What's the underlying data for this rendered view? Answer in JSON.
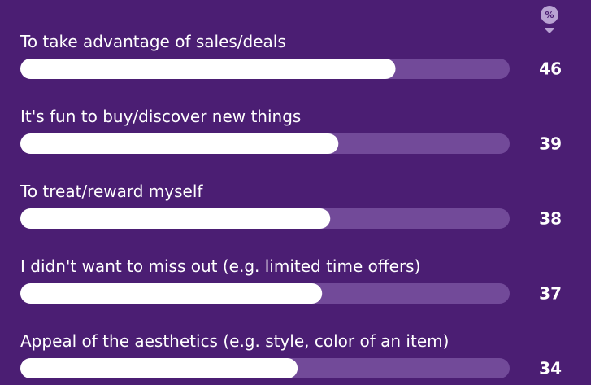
{
  "unit_badge": "%",
  "colors": {
    "background": "#4b1e73",
    "track": "#724a99",
    "fill": "#ffffff",
    "badge": "#b9a3d3",
    "text": "#ffffff"
  },
  "chart_data": {
    "type": "bar",
    "orientation": "horizontal",
    "categories": [
      "To take advantage of sales/deals",
      "It's fun to buy/discover new things",
      "To treat/reward myself",
      "I didn't want to miss out (e.g. limited time offers)",
      "Appeal of the aesthetics (e.g. style, color of an item)"
    ],
    "values": [
      46,
      39,
      38,
      37,
      34
    ],
    "unit": "%",
    "xlim": [
      0,
      60
    ],
    "grid": false,
    "legend": "none"
  }
}
